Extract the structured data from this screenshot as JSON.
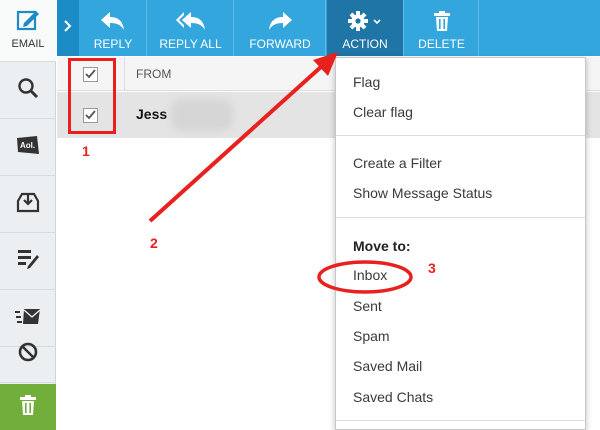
{
  "rail": {
    "email_label": "EMAIL",
    "items": [
      "search-icon",
      "aol-logo-icon",
      "inbox-download-icon",
      "compose-icon",
      "send-mail-icon",
      "block-icon",
      "trash-icon"
    ]
  },
  "toolbar": {
    "reply_label": "REPLY",
    "reply_all_label": "REPLY ALL",
    "forward_label": "FORWARD",
    "action_label": "ACTION",
    "delete_label": "DELETE"
  },
  "list": {
    "from_header": "FROM",
    "rows": [
      {
        "sender_visible": "Jess"
      }
    ]
  },
  "menu": {
    "flag": "Flag",
    "clear_flag": "Clear flag",
    "create_filter": "Create a Filter",
    "show_status": "Show Message Status",
    "move_to": "Move to:",
    "inbox": "Inbox",
    "sent": "Sent",
    "spam": "Spam",
    "saved_mail": "Saved Mail",
    "saved_chats": "Saved Chats"
  },
  "annotations": {
    "one": "1",
    "two": "2",
    "three": "3"
  },
  "colors": {
    "toolbar": "#33a7dd",
    "toolbar_active": "#1f75a6",
    "annotation_red": "#e8211f",
    "trash_green": "#72ae3a"
  }
}
